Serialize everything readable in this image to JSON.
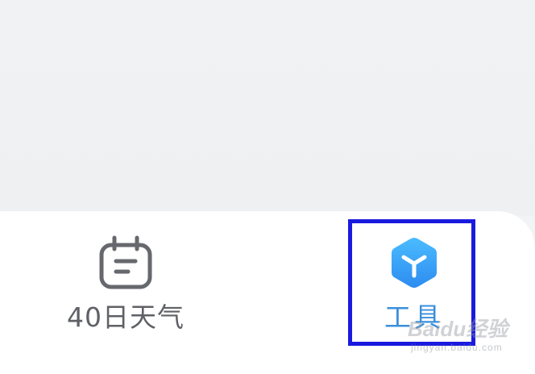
{
  "tabbar": {
    "tabs": [
      {
        "label": "40日天气",
        "icon": "calendar-icon",
        "active": false
      },
      {
        "label": "工具",
        "icon": "cube-icon",
        "active": true
      }
    ]
  },
  "colors": {
    "active_label": "#3a8fdc",
    "inactive_label": "#5f6166",
    "highlight_border": "#1a1adf",
    "tool_icon_gradient": [
      "#47b8ff",
      "#2f8ff2"
    ]
  },
  "watermark": {
    "brand": "Baidu经验",
    "url": "jingyan.baidu.com"
  }
}
